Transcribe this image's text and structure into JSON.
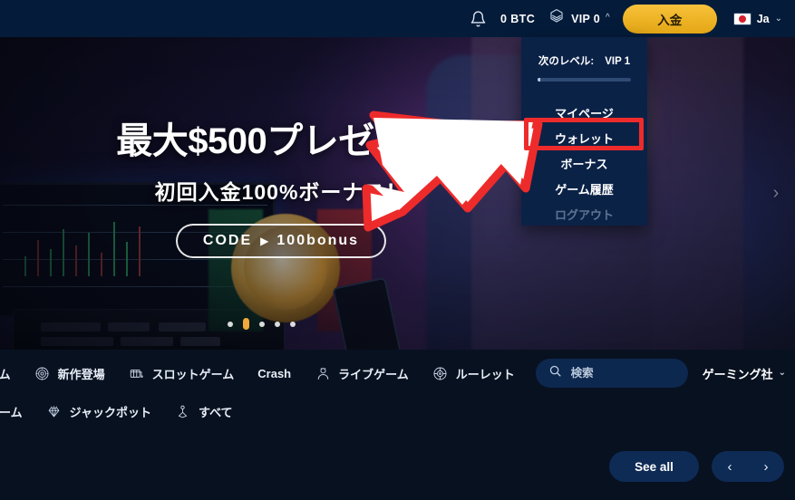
{
  "header": {
    "notifications_icon": "bell-icon",
    "balance": "0 BTC",
    "vip_icon": "vip-hexagon-icon",
    "vip_label": "VIP 0",
    "vip_caret": "^",
    "deposit_label": "入金",
    "language_label": "Ja",
    "language_caret": "⌄",
    "flag": "japan-flag"
  },
  "dropdown": {
    "level_label": "次のレベル:",
    "level_value": "VIP 1",
    "progress_percent": 3,
    "items": [
      {
        "label": "マイページ",
        "disabled": false
      },
      {
        "label": "ウォレット",
        "disabled": false
      },
      {
        "label": "ボーナス",
        "disabled": false
      },
      {
        "label": "ゲーム履歴",
        "disabled": false
      },
      {
        "label": "ログアウト",
        "disabled": true
      }
    ]
  },
  "hero": {
    "title": "最大$500プレゼント",
    "subtitle": "初回入金100%ボーナス！",
    "code_label": "CODE",
    "code_arrow": "▶",
    "code_value": "100bonus",
    "next_arrow": "›",
    "dots": 5,
    "active_dot": 1
  },
  "annotation": {
    "highlight_target": "ウォレット",
    "highlight_color": "#ee2b2b",
    "arrow_fill": "#ffffff",
    "arrow_stroke": "#ee2b2b"
  },
  "gamenav": {
    "row1": [
      {
        "label": "ーム",
        "icon": "",
        "clipped": true
      },
      {
        "label": "新作登場",
        "icon": "target-icon"
      },
      {
        "label": "スロットゲーム",
        "icon": "slot-machine-icon"
      },
      {
        "label": "Crash",
        "icon": ""
      },
      {
        "label": "ライブゲーム",
        "icon": "dealer-icon"
      },
      {
        "label": "ルーレット",
        "icon": "roulette-icon"
      }
    ],
    "row2": [
      {
        "label": "ゲーム",
        "icon": "",
        "clipped": true
      },
      {
        "label": "ジャックポット",
        "icon": "diamond-icon"
      },
      {
        "label": "すべて",
        "icon": "joystick-icon"
      }
    ],
    "search_placeholder": "検索",
    "search_value": "",
    "search_icon": "search-icon",
    "provider_label": "ゲーミング社",
    "provider_caret": "⌄"
  },
  "bottombar": {
    "see_all_label": "See all",
    "prev_arrow": "‹",
    "next_arrow": "›"
  },
  "colors": {
    "header_bg": "#041c3a",
    "page_bg": "#081120",
    "accent_gold": "#edb325",
    "dropdown_bg": "#0b2247",
    "annotation_red": "#ee2b2b",
    "button_blue": "#0d2b55"
  }
}
